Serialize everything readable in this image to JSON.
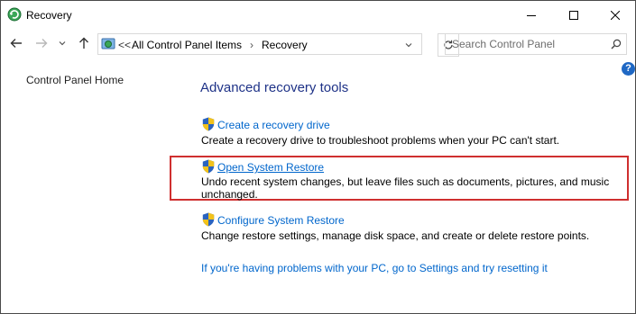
{
  "window": {
    "title": "Recovery"
  },
  "address": {
    "overflow": "<<",
    "crumbs": [
      "All Control Panel Items",
      "Recovery"
    ]
  },
  "search": {
    "placeholder": "Search Control Panel"
  },
  "help": {
    "label": "?"
  },
  "sidebar": {
    "home": "Control Panel Home"
  },
  "main": {
    "heading": "Advanced recovery tools",
    "items": [
      {
        "link": "Create a recovery drive",
        "description": "Create a recovery drive to troubleshoot problems when your PC can't start."
      },
      {
        "link": "Open System Restore",
        "description_line1": "Undo recent system changes, but leave files such as documents, pictures, and music",
        "description_line2": "unchanged."
      },
      {
        "link": "Configure System Restore",
        "description": "Change restore settings, manage disk space, and create or delete restore points."
      }
    ],
    "reset_link": "If you're having problems with your PC, go to Settings and try resetting it"
  },
  "colors": {
    "link": "#0066cc",
    "heading": "#1e3287",
    "highlight": "#cf2f2f"
  }
}
